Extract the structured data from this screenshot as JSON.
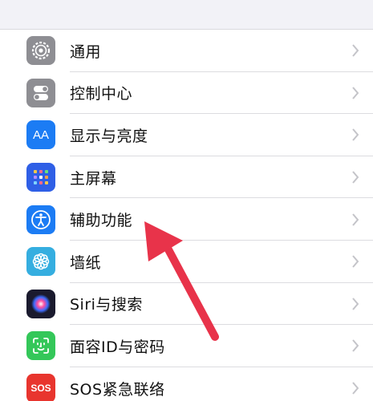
{
  "settings": {
    "items": [
      {
        "label": "通用",
        "icon": "gear-icon",
        "color": "#8e8e93"
      },
      {
        "label": "控制中心",
        "icon": "toggle-switches-icon",
        "color": "#8e8e93"
      },
      {
        "label": "显示与亮度",
        "icon": "text-size-icon",
        "color": "#1c7cf4",
        "icon_text": "AA"
      },
      {
        "label": "主屏幕",
        "icon": "home-grid-icon",
        "color": "#2f5fe6"
      },
      {
        "label": "辅助功能",
        "icon": "accessibility-icon",
        "color": "#1c7cf4"
      },
      {
        "label": "墙纸",
        "icon": "flower-icon",
        "color": "#35aee0"
      },
      {
        "label": "Siri与搜索",
        "icon": "siri-icon",
        "color": "#1a1a2e"
      },
      {
        "label": "面容ID与密码",
        "icon": "face-id-icon",
        "color": "#34c759"
      },
      {
        "label": "SOS紧急联络",
        "icon": "sos-icon",
        "color": "#e8352e",
        "icon_text": "SOS"
      }
    ]
  },
  "annotation": {
    "color": "#e8334a"
  }
}
